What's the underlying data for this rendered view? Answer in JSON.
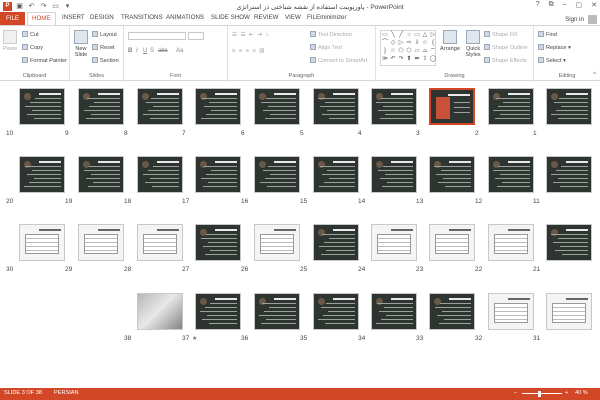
{
  "window": {
    "title": "پاورپوینت استفاده از نقشه شناختی در استراتژی - PowerPoint",
    "signin": "Sign in",
    "min": "–",
    "max": "▢",
    "close": "✕",
    "help": "?",
    "restore": "⧉"
  },
  "tabs": [
    "FILE",
    "HOME",
    "INSERT",
    "DESIGN",
    "TRANSITIONS",
    "ANIMATIONS",
    "SLIDE SHOW",
    "REVIEW",
    "VIEW",
    "FILEminimizer"
  ],
  "ribbon": {
    "clipboard": {
      "paste": "Paste",
      "cut": "Cut",
      "copy": "Copy",
      "format_painter": "Format Painter",
      "label": "Clipboard"
    },
    "slides": {
      "new_slide": "New",
      "new_slide2": "Slide",
      "layout": "Layout",
      "reset": "Reset",
      "section": "Section",
      "label": "Slides"
    },
    "font": {
      "label": "Font",
      "bold": "B",
      "italic": "I",
      "underline": "U",
      "strike": "S",
      "abc": "abc",
      "aa": "Aa"
    },
    "paragraph": {
      "text_direction": "Text Direction",
      "align_text": "Align Text",
      "convert": "Convert to SmartArt",
      "label": "Paragraph"
    },
    "drawing": {
      "arrange": "Arrange",
      "quick_styles": "Quick",
      "quick_styles2": "Styles",
      "shape_fill": "Shape Fill",
      "shape_outline": "Shape Outline",
      "shape_effects": "Shape Effects",
      "label": "Drawing"
    },
    "editing": {
      "find": "Find",
      "replace": "Replace",
      "select": "Select",
      "label": "Editing"
    }
  },
  "slides": [
    {
      "n": "10"
    },
    {
      "n": "9"
    },
    {
      "n": "8"
    },
    {
      "n": "7"
    },
    {
      "n": "6"
    },
    {
      "n": "5"
    },
    {
      "n": "4"
    },
    {
      "n": "3"
    },
    {
      "n": "2"
    },
    {
      "n": "1"
    },
    {
      "n": "20"
    },
    {
      "n": "19"
    },
    {
      "n": "18"
    },
    {
      "n": "17"
    },
    {
      "n": "16"
    },
    {
      "n": "15"
    },
    {
      "n": "14"
    },
    {
      "n": "13"
    },
    {
      "n": "12"
    },
    {
      "n": "11"
    },
    {
      "n": "30"
    },
    {
      "n": "29"
    },
    {
      "n": "28"
    },
    {
      "n": "27"
    },
    {
      "n": "26"
    },
    {
      "n": "25"
    },
    {
      "n": "24"
    },
    {
      "n": "23"
    },
    {
      "n": "22"
    },
    {
      "n": "21"
    },
    {
      "n": "38"
    },
    {
      "n": "37"
    },
    {
      "n": "36"
    },
    {
      "n": "35"
    },
    {
      "n": "34"
    },
    {
      "n": "33"
    },
    {
      "n": "32"
    },
    {
      "n": "31"
    }
  ],
  "selected_slide": "3",
  "status": {
    "slide_info": "SLIDE 3 OF 38",
    "language": "PERSIAN",
    "zoom": "40 %",
    "zoom_minus": "–",
    "zoom_plus": "+"
  },
  "colors": {
    "accent": "#d24726",
    "slide_bg": "#2e3430"
  },
  "icons": {
    "star": "★",
    "collapse": "^",
    "shapes": [
      "▭",
      "╲",
      "╱",
      "○",
      "▭",
      "△",
      "▷",
      "⌒",
      "◇",
      "▷",
      "⇨",
      "⇩",
      "☆",
      "{",
      "}",
      "☆",
      "⬠",
      "⬡",
      "▱",
      "⌓",
      "⌔",
      "≫",
      "↶",
      "↷",
      "⬆",
      "⬅",
      "⇧",
      "◯"
    ]
  }
}
